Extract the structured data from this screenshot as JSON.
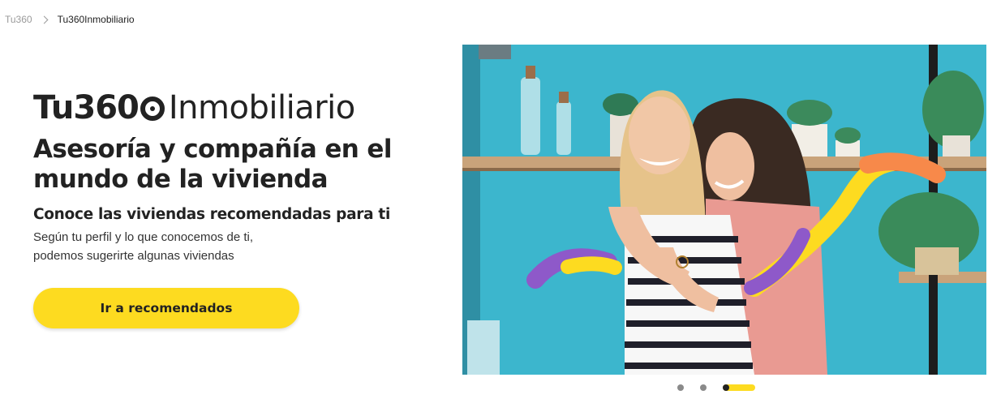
{
  "breadcrumb": {
    "root": "Tu360",
    "current": "Tu360Inmobiliario"
  },
  "logo": {
    "bold": "Tu360",
    "light": "Inmobiliario"
  },
  "hero": {
    "headline_line1": "Asesoría y compañía en el",
    "headline_line2": "mundo de la vivienda",
    "subheadline": "Conoce las viviendas recomendadas para ti",
    "body_line1": "Según tu perfil y lo que conocemos de ti,",
    "body_line2": "podemos sugerirte algunas viviendas",
    "cta_label": "Ir a recomendados"
  },
  "carousel": {
    "image_icon": "photo-two-women-hugging",
    "slide_count": 3,
    "active_slide": 3
  },
  "colors": {
    "accent_yellow": "#fddb20",
    "text_dark": "#222222",
    "muted": "#9a9a9a",
    "photo_wall": "#3cb6cd",
    "stroke_purple": "#8e59c9",
    "stroke_orange": "#f7894a"
  }
}
